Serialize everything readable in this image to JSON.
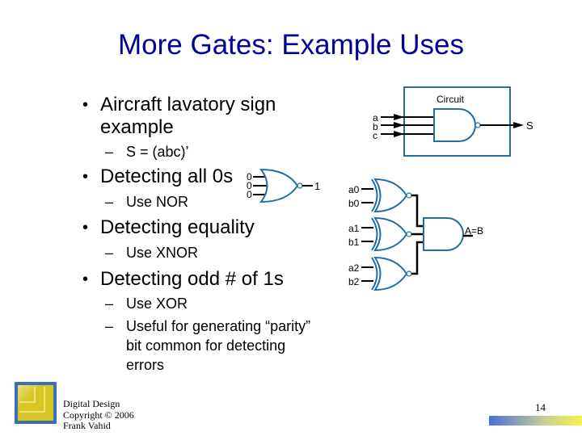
{
  "slide": {
    "title": "More Gates: Example Uses",
    "page_number": "14",
    "footer": {
      "line1": "Digital Design",
      "line2": "Copyright © 2006",
      "line3": "Frank Vahid"
    }
  },
  "bullets": [
    {
      "text_line1": "Aircraft lavatory sign",
      "text_line2": "example",
      "sub": [
        "S = (abc)’"
      ]
    },
    {
      "text_line1": "Detecting all 0s",
      "sub": [
        "Use NOR"
      ]
    },
    {
      "text_line1": "Detecting equality",
      "sub": [
        "Use XNOR"
      ]
    },
    {
      "text_line1": "Detecting odd # of 1s",
      "sub": [
        "Use XOR",
        "Useful for generating “parity”",
        "bit common for detecting",
        "errors"
      ]
    }
  ],
  "diagrams": {
    "colors": {
      "gate_stroke": "#1f6fa0",
      "wire": "#000000"
    },
    "circuit_nand": {
      "box_label": "Circuit",
      "inputs": [
        "a",
        "b",
        "c"
      ],
      "output": "S",
      "gate": "NAND"
    },
    "nor_example": {
      "inputs": [
        "0",
        "0",
        "0"
      ],
      "output": "1",
      "gate": "NOR"
    },
    "equality": {
      "inputs": [
        [
          "a0",
          "b0"
        ],
        [
          "a1",
          "b1"
        ],
        [
          "a2",
          "b2"
        ]
      ],
      "gates": "XNOR",
      "combiner": "AND",
      "output": "A=B"
    }
  }
}
